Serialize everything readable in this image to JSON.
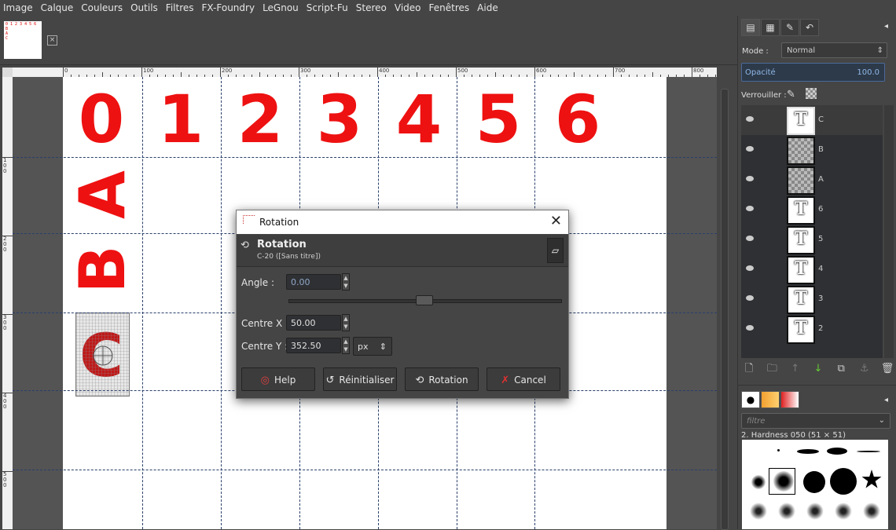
{
  "menu": [
    "Image",
    "Calque",
    "Couleurs",
    "Outils",
    "Filtres",
    "FX-Foundry",
    "LeGnou",
    "Script-Fu",
    "Stereo",
    "Video",
    "Fenêtres",
    "Aide"
  ],
  "thumbnail": {
    "text": "0 1 2 3 4 5 6\nB\nA\nC",
    "close_icon": "close-icon"
  },
  "ruler": {
    "top_labels": [
      "0",
      "100",
      "200",
      "300",
      "400",
      "500",
      "600",
      "700",
      "800"
    ],
    "left_labels": [
      "1 0 0",
      "2 0 0",
      "3 0 0",
      "4 0 0",
      "5 0 0"
    ]
  },
  "canvas": {
    "digits": [
      "0",
      "1",
      "2",
      "3",
      "4",
      "5",
      "6"
    ],
    "letters": [
      "A",
      "B"
    ],
    "preview_letter": "C",
    "text_color": "#ee1111"
  },
  "dock": {
    "tabs": [
      "layers-icon",
      "channels-icon",
      "paths-icon",
      "undo-icon"
    ],
    "mode_label": "Mode :",
    "mode_value": "Normal",
    "opacity_label": "Opacité",
    "opacity_value": "100.0",
    "lock_label": "Verrouiller :",
    "layers": [
      {
        "name": "C",
        "type": "text",
        "selected": true
      },
      {
        "name": "B",
        "type": "raster"
      },
      {
        "name": "A",
        "type": "raster"
      },
      {
        "name": "6",
        "type": "text"
      },
      {
        "name": "5",
        "type": "text"
      },
      {
        "name": "4",
        "type": "text"
      },
      {
        "name": "3",
        "type": "text"
      },
      {
        "name": "2",
        "type": "text"
      }
    ],
    "filter_placeholder": "filtre",
    "brush_name": "2. Hardness 050 (51 × 51)"
  },
  "dialog": {
    "window_title": "Rotation",
    "header_title": "Rotation",
    "header_subtitle": "C-20 ([Sans titre])",
    "angle_label": "Angle :",
    "angle_value": "0.00",
    "centre_x_label": "Centre X :",
    "centre_x_value": "50.00",
    "centre_y_label": "Centre Y :",
    "centre_y_value": "352.50",
    "unit": "px",
    "buttons": {
      "help": "Help",
      "reset": "Réinitialiser",
      "rotate": "Rotation",
      "cancel": "Cancel"
    }
  }
}
